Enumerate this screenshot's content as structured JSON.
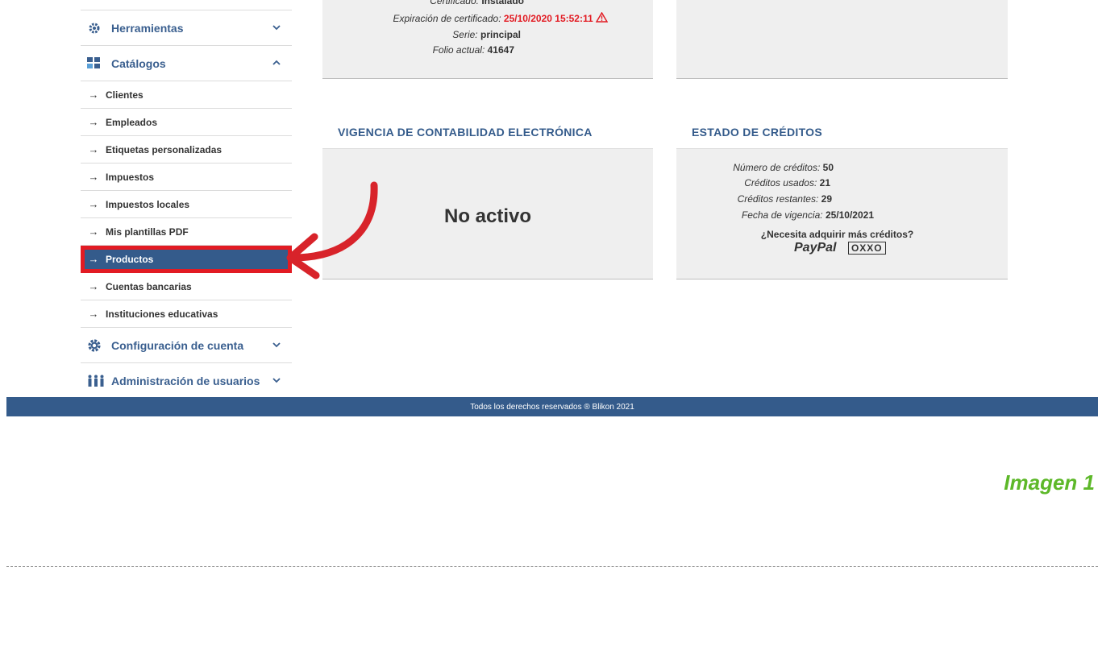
{
  "sidebar": {
    "sections": {
      "herramientas": "Herramientas",
      "catalogos": "Catálogos",
      "configuracion": "Configuración de cuenta",
      "administracion": "Administración de usuarios"
    },
    "catalog_items": [
      {
        "label": "Clientes"
      },
      {
        "label": "Empleados"
      },
      {
        "label": "Etiquetas personalizadas"
      },
      {
        "label": "Impuestos"
      },
      {
        "label": "Impuestos locales"
      },
      {
        "label": "Mis plantillas PDF"
      },
      {
        "label": "Productos",
        "active": true
      },
      {
        "label": "Cuentas bancarias"
      },
      {
        "label": "Instituciones educativas"
      }
    ],
    "arrow_glyph": "→"
  },
  "certificate": {
    "cert_label": "Certificado:",
    "cert_value": "Instalado",
    "expiration_label": "Expiración de certificado:",
    "expiration_value": "25/10/2020 15:52:11",
    "serie_label": "Serie:",
    "serie_value": "principal",
    "folio_label": "Folio actual:",
    "folio_value": "41647"
  },
  "contabilidad": {
    "header": "VIGENCIA DE CONTABILIDAD ELECTRÓNICA",
    "status": "No activo"
  },
  "creditos": {
    "header": "ESTADO DE CRÉDITOS",
    "numero_label": "Número de créditos:",
    "numero_value": "50",
    "usados_label": "Créditos usados:",
    "usados_value": "21",
    "restantes_label": "Créditos restantes:",
    "restantes_value": "29",
    "vigencia_label": "Fecha de vigencia:",
    "vigencia_value": "25/10/2021",
    "buy_text": "¿Necesita adquirir más créditos?",
    "paypal": "PayPal",
    "oxxo": "OXXO"
  },
  "footer": {
    "text": "Todos los derechos reservados ® Blikon 2021"
  },
  "caption": "Imagen 1",
  "colors": {
    "brand_blue": "#345b8b",
    "highlight_red": "#e21b23",
    "caption_green": "#5db829",
    "panel_gray": "#efefef"
  }
}
